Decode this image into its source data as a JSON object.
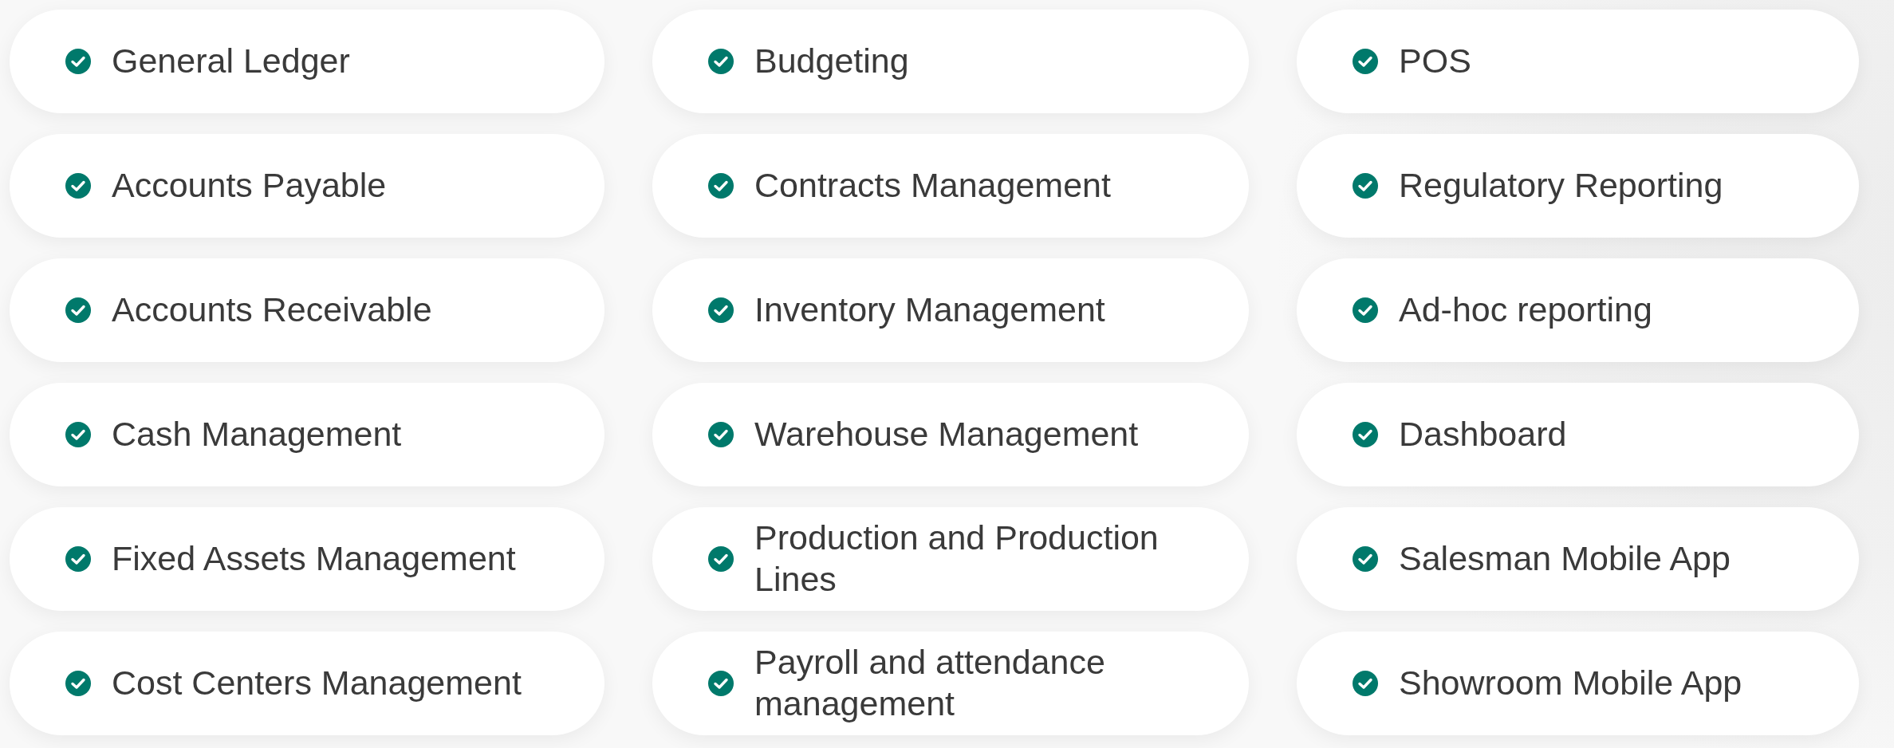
{
  "rows": [
    {
      "features": [
        {
          "label": "General Ledger",
          "checked": true
        },
        {
          "label": "Budgeting",
          "checked": true
        },
        {
          "label": "POS",
          "checked": true
        }
      ]
    },
    {
      "features": [
        {
          "label": "Accounts Payable",
          "checked": true
        },
        {
          "label": "Contracts Management",
          "checked": true
        },
        {
          "label": "Regulatory Reporting",
          "checked": true
        }
      ]
    },
    {
      "features": [
        {
          "label": "Accounts Receivable",
          "checked": true
        },
        {
          "label": "Inventory Management",
          "checked": true
        },
        {
          "label": "Ad-hoc reporting",
          "checked": true
        }
      ]
    },
    {
      "features": [
        {
          "label": "Cash Management",
          "checked": true
        },
        {
          "label": "Warehouse Management",
          "checked": true
        },
        {
          "label": "Dashboard",
          "checked": true
        }
      ]
    },
    {
      "features": [
        {
          "label": "Fixed Assets Management",
          "checked": true
        },
        {
          "label": "Production and Production Lines",
          "checked": true
        },
        {
          "label": "Salesman Mobile App",
          "checked": true
        }
      ]
    },
    {
      "features": [
        {
          "label": "Cost Centers Management",
          "checked": true
        },
        {
          "label": "Payroll and attendance management",
          "checked": true
        },
        {
          "label": "Showroom Mobile App",
          "checked": true
        }
      ]
    }
  ]
}
